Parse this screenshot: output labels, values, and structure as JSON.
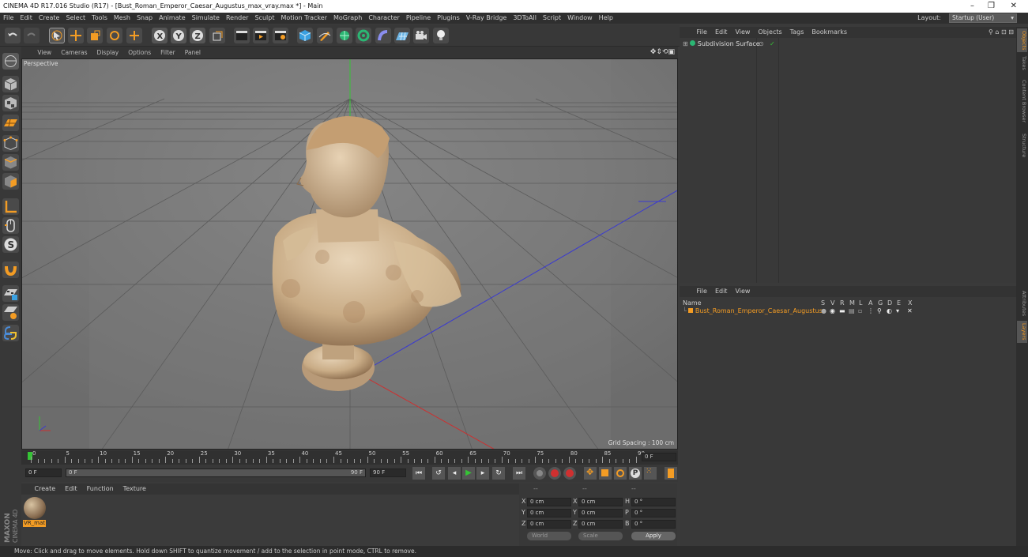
{
  "window": {
    "title": "CINEMA 4D R17.016 Studio (R17) - [Bust_Roman_Emperor_Caesar_Augustus_max_vray.max *] - Main",
    "controls": [
      "–",
      "❐",
      "✕"
    ]
  },
  "menubar": {
    "items": [
      "File",
      "Edit",
      "Create",
      "Select",
      "Tools",
      "Mesh",
      "Snap",
      "Animate",
      "Simulate",
      "Render",
      "Sculpt",
      "Motion Tracker",
      "MoGraph",
      "Character",
      "Pipeline",
      "Plugins",
      "V-Ray Bridge",
      "3DToAll",
      "Script",
      "Window",
      "Help"
    ],
    "layout_label": "Layout:",
    "layout_value": "Startup (User)"
  },
  "viewport": {
    "menu": [
      "View",
      "Cameras",
      "Display",
      "Options",
      "Filter",
      "Panel"
    ],
    "label": "Perspective",
    "grid_spacing": "Grid Spacing : 100 cm"
  },
  "timeline": {
    "ticks": [
      "0",
      "5",
      "10",
      "15",
      "20",
      "25",
      "30",
      "35",
      "40",
      "45",
      "50",
      "55",
      "60",
      "65",
      "70",
      "75",
      "80",
      "85",
      "90"
    ],
    "frame_end_field": "0 F",
    "start_field": "0 F",
    "slider_left": "0 F",
    "slider_right": "90 F",
    "end_field": "90 F"
  },
  "material_manager": {
    "menu": [
      "Create",
      "Edit",
      "Function",
      "Texture"
    ],
    "materials": [
      {
        "name": "VR_mat"
      }
    ]
  },
  "coordinates": {
    "header": [
      "--",
      "--",
      "--"
    ],
    "rows": [
      {
        "a": "X",
        "av": "0 cm",
        "b": "X",
        "bv": "0 cm",
        "c": "H",
        "cv": "0 °"
      },
      {
        "a": "Y",
        "av": "0 cm",
        "b": "Y",
        "bv": "0 cm",
        "c": "P",
        "cv": "0 °"
      },
      {
        "a": "Z",
        "av": "0 cm",
        "b": "Z",
        "bv": "0 cm",
        "c": "B",
        "cv": "0 °"
      }
    ],
    "world": "World",
    "scale": "Scale",
    "apply": "Apply"
  },
  "object_manager": {
    "menu": [
      "File",
      "Edit",
      "View",
      "Objects",
      "Tags",
      "Bookmarks"
    ],
    "objects": [
      {
        "name": "Subdivision Surface"
      }
    ]
  },
  "layer_manager": {
    "menu": [
      "File",
      "Edit",
      "View"
    ],
    "columns": [
      "Name",
      "S",
      "V",
      "R",
      "M",
      "L",
      "A",
      "G",
      "D",
      "E",
      "X"
    ],
    "layers": [
      {
        "name": "Bust_Roman_Emperor_Caesar_Augustus"
      }
    ]
  },
  "right_tabs": [
    "Objects",
    "Takes",
    "Content Browser",
    "Structure",
    "Attributes",
    "Layers"
  ],
  "status": "Move: Click and drag to move elements. Hold down SHIFT to quantize movement / add to the selection in point mode, CTRL to remove.",
  "brand": {
    "maxon": "MAXON",
    "c4d": "CINEMA 4D"
  }
}
